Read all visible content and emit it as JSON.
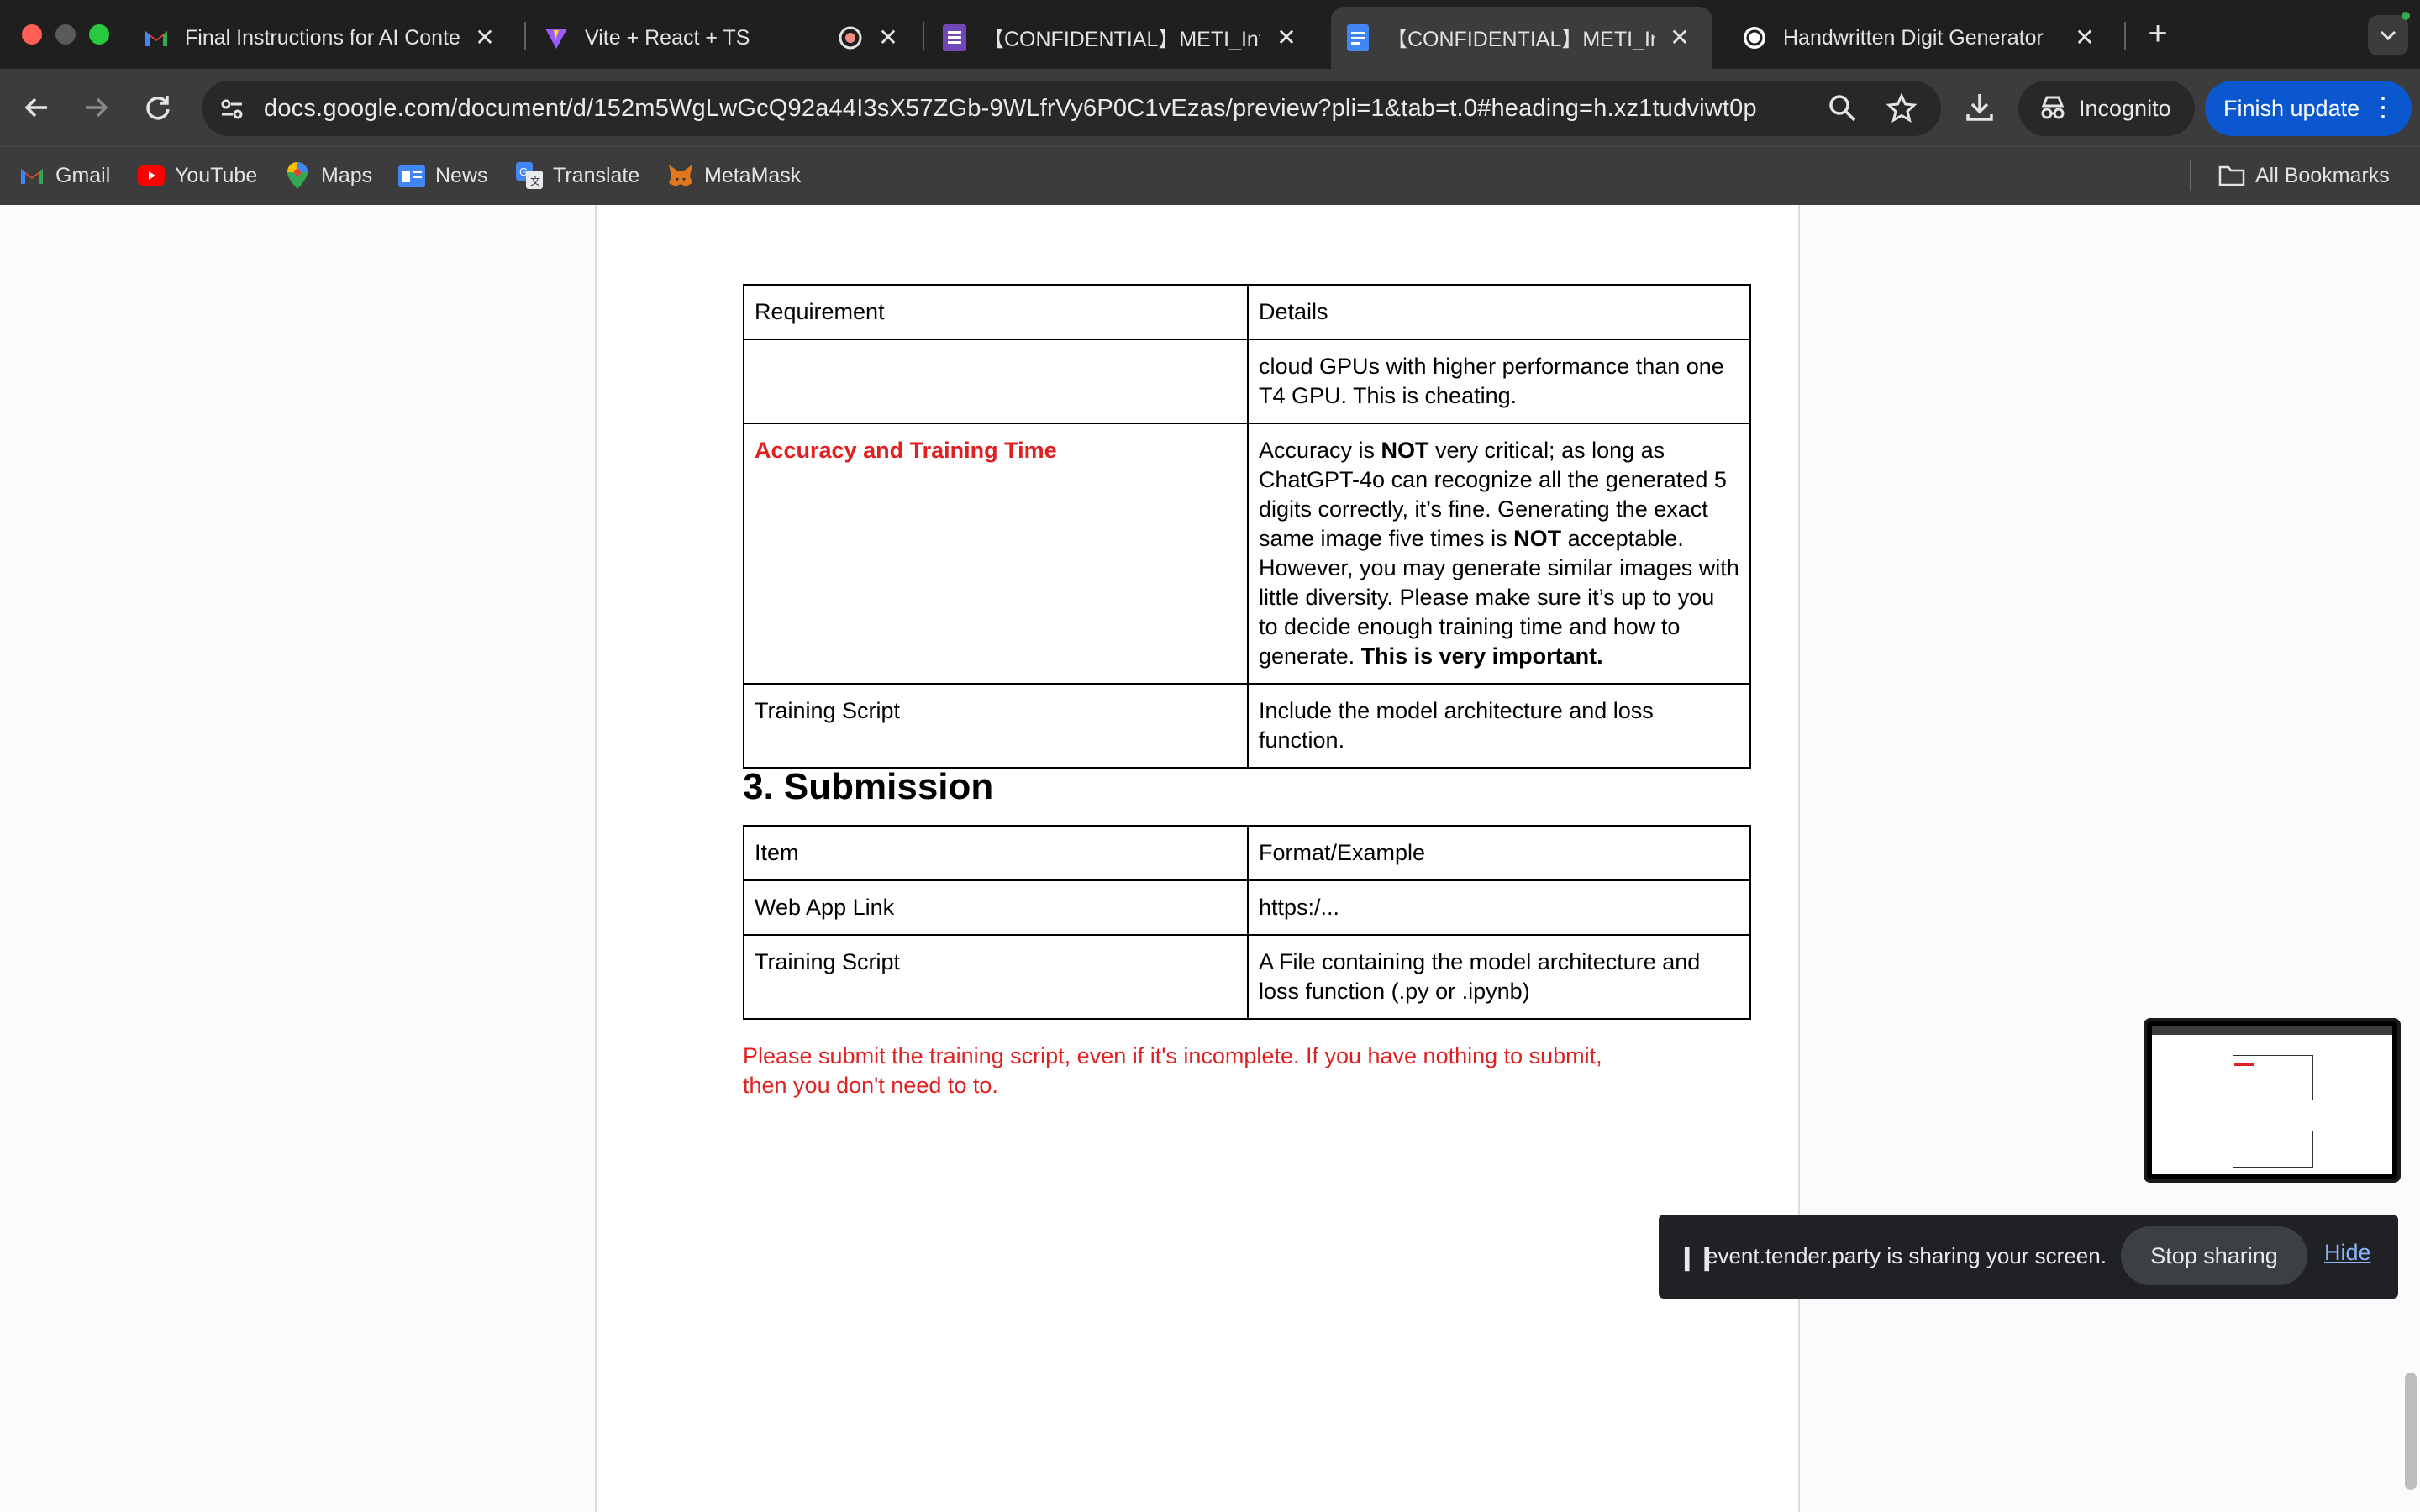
{
  "browser": {
    "tabs": [
      {
        "title": "Final Instructions for AI Conte",
        "icon": "gmail-icon"
      },
      {
        "title": "Vite + React + TS",
        "icon": "vite-icon"
      },
      {
        "title": "",
        "icon": "recording-icon"
      },
      {
        "title": "【CONFIDENTIAL】METI_Inte",
        "icon": "forms-icon"
      },
      {
        "title": "【CONFIDENTIAL】METI_Inte",
        "icon": "docs-icon",
        "active": true
      },
      {
        "title": "Handwritten Digit Generator",
        "icon": "openai-icon"
      }
    ],
    "url": "docs.google.com/document/d/152m5WgLwGcQ92a44I3sX57ZGb-9WLfrVy6P0C1vEzas/preview?pli=1&tab=t.0#heading=h.xz1tudviwt0p",
    "incognito_label": "Incognito",
    "update_label": "Finish update",
    "bookmarks": [
      "Gmail",
      "YouTube",
      "Maps",
      "News",
      "Translate",
      "MetaMask"
    ],
    "all_bookmarks_label": "All Bookmarks"
  },
  "document": {
    "table1": {
      "headers": [
        "Requirement",
        "Details"
      ],
      "row_cont": {
        "req": "",
        "details": "cloud GPUs with higher performance than one T4 GPU. This is cheating."
      },
      "row_accuracy": {
        "req": "Accuracy and Training Time",
        "d1": "Accuracy is ",
        "d2": "NOT",
        "d3": " very critical; as long as ChatGPT-4o can recognize all the generated 5 digits correctly, it’s fine. Generating the exact same image five times is ",
        "d4": "NOT",
        "d5": " acceptable. However, you may generate similar images with little diversity. Please make sure it’s up to you to decide enough training time and how to generate. ",
        "d6": "This is very important."
      },
      "row_script": {
        "req": "Training Script",
        "details": "Include the model architecture and loss function."
      }
    },
    "section_heading": "3. Submission",
    "table2": {
      "headers": [
        "Item",
        "Format/Example"
      ],
      "rows": [
        {
          "item": "Web App Link",
          "format": "https:/..."
        },
        {
          "item": "Training Script",
          "format": "A File containing the model architecture and loss function (.py or .ipynb)"
        }
      ]
    },
    "note": "Please submit the training script, even if it's incomplete. If you have nothing to submit, then you don't need to to."
  },
  "screen_share": {
    "message": "event.tender.party is sharing your screen.",
    "stop_label": "Stop sharing",
    "hide_label": "Hide"
  },
  "colors": {
    "accent_red": "#e02020",
    "chrome_dark": "#1f1f1f",
    "update_blue": "#0b57d0"
  }
}
